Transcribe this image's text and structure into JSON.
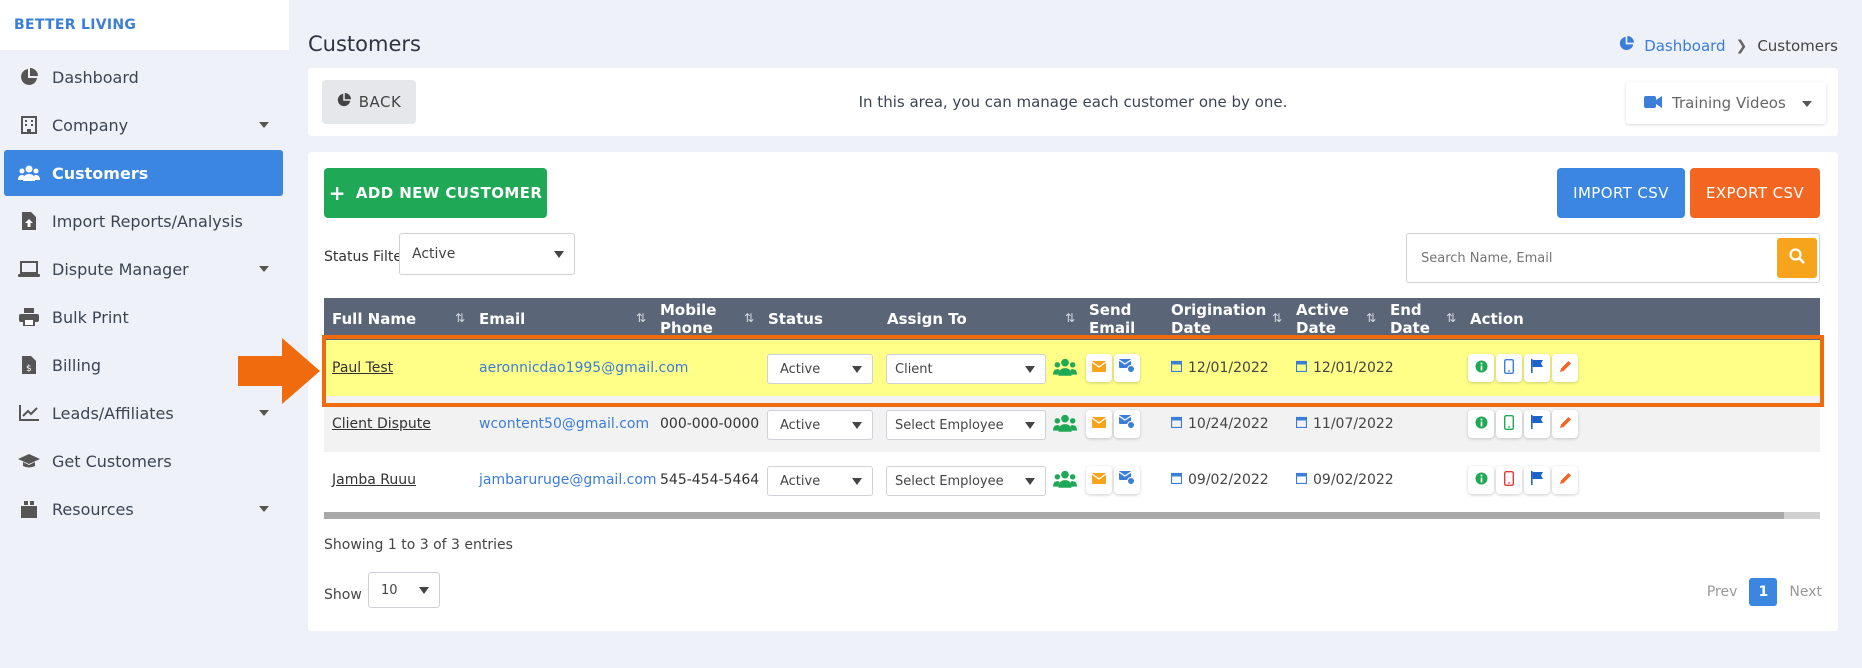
{
  "sidebar": {
    "brand": "BETTER LIVING",
    "items": [
      {
        "label": "Dashboard",
        "icon": "pie-chart-icon",
        "has_caret": false,
        "active": false
      },
      {
        "label": "Company",
        "icon": "building-icon",
        "has_caret": true,
        "active": false
      },
      {
        "label": "Customers",
        "icon": "users-icon",
        "has_caret": false,
        "active": true
      },
      {
        "label": "Import Reports/Analysis",
        "icon": "file-upload-icon",
        "has_caret": false,
        "active": false
      },
      {
        "label": "Dispute Manager",
        "icon": "laptop-icon",
        "has_caret": true,
        "active": false
      },
      {
        "label": "Bulk Print",
        "icon": "printer-icon",
        "has_caret": false,
        "active": false
      },
      {
        "label": "Billing",
        "icon": "invoice-icon",
        "has_caret": false,
        "active": false
      },
      {
        "label": "Leads/Affiliates",
        "icon": "line-chart-icon",
        "has_caret": true,
        "active": false
      },
      {
        "label": "Get Customers",
        "icon": "graduation-cap-icon",
        "has_caret": false,
        "active": false
      },
      {
        "label": "Resources",
        "icon": "box-icon",
        "has_caret": true,
        "active": false
      }
    ]
  },
  "header": {
    "title": "Customers",
    "breadcrumb": {
      "home": "Dashboard",
      "current": "Customers"
    }
  },
  "toolbar": {
    "back_label": "BACK",
    "message": "In this area, you can manage each customer one by one.",
    "training_label": "Training Videos"
  },
  "actions": {
    "add_label": "ADD NEW CUSTOMER",
    "import_label": "IMPORT CSV",
    "export_label": "EXPORT CSV"
  },
  "filter": {
    "label": "Status Filter",
    "value": "Active"
  },
  "search": {
    "placeholder": "Search Name, Email"
  },
  "table": {
    "columns": [
      "Full Name",
      "Email",
      "Mobile Phone",
      "Status",
      "Assign To",
      "Send Email",
      "Origination Date",
      "Active Date",
      "End Date",
      "Action"
    ],
    "rows": [
      {
        "name": "Paul Test",
        "email": "aeronnicdao1995@gmail.com",
        "phone": "",
        "status": "Active",
        "assign": "Client",
        "origination": "12/01/2022",
        "active": "12/01/2022",
        "end": "",
        "phone_icon_color": "#3b7dd8",
        "highlighted": true
      },
      {
        "name": "Client Dispute",
        "email": "wcontent50@gmail.com",
        "phone": "000-000-0000",
        "status": "Active",
        "assign": "Select Employee",
        "origination": "10/24/2022",
        "active": "11/07/2022",
        "end": "",
        "phone_icon_color": "#1fa855",
        "highlighted": false
      },
      {
        "name": "Jamba Ruuu",
        "email": "jambaruruge@gmail.com",
        "phone": "545-454-5464",
        "status": "Active",
        "assign": "Select Employee",
        "origination": "09/02/2022",
        "active": "09/02/2022",
        "end": "",
        "phone_icon_color": "#e53935",
        "highlighted": false
      }
    ]
  },
  "footer": {
    "entries_text": "Showing 1 to 3 of 3 entries",
    "show_label": "Show",
    "page_size": "10",
    "prev_label": "Prev",
    "current_page": "1",
    "next_label": "Next"
  },
  "colors": {
    "accent_blue": "#3b86e0",
    "success_green": "#1fa855",
    "warning_orange": "#f26622",
    "search_yellow": "#f7a41d",
    "highlight_yellow": "#ffff88",
    "annotation_orange": "#f06b0e"
  }
}
